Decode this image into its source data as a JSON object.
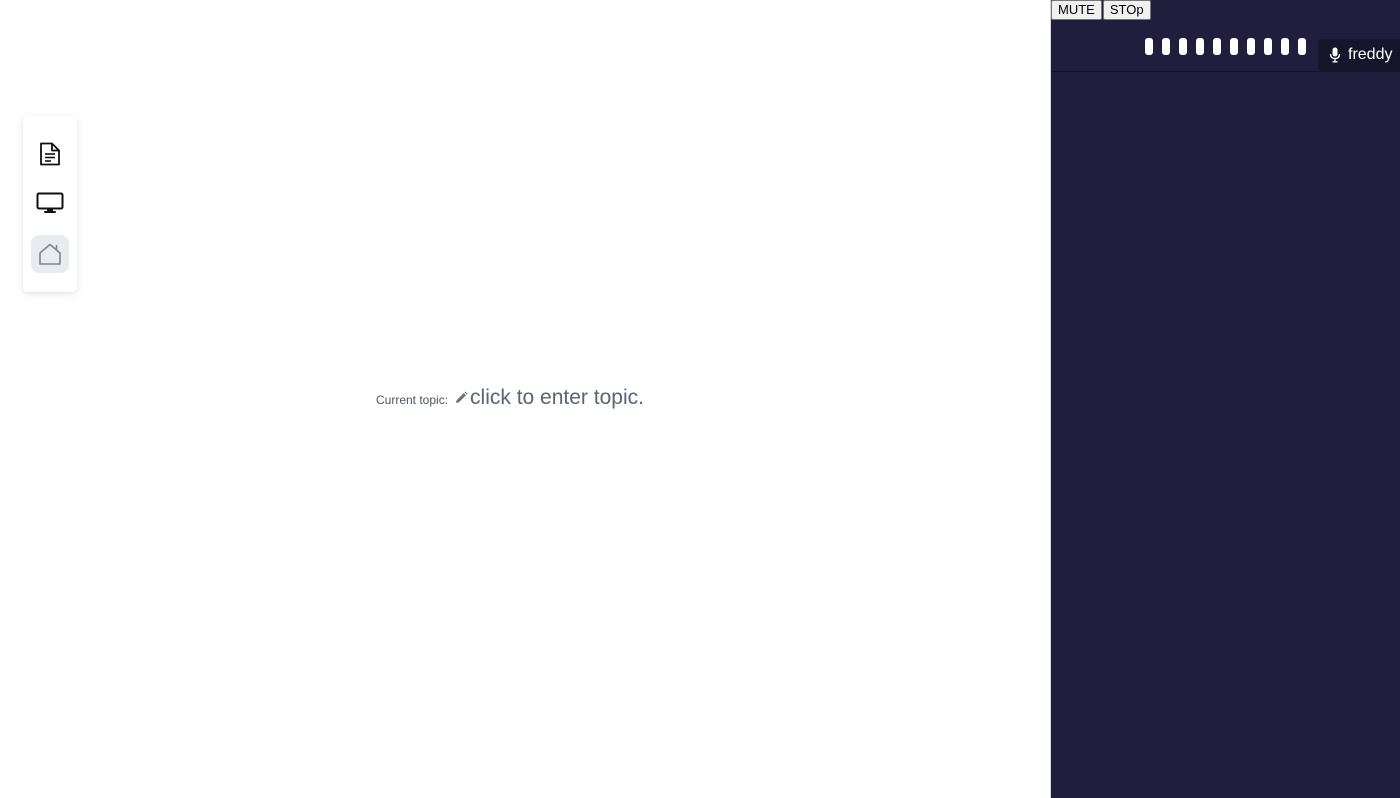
{
  "toolbar": {
    "items": [
      {
        "icon": "document-icon"
      },
      {
        "icon": "monitor-icon"
      },
      {
        "icon": "home-icon",
        "active": true
      }
    ]
  },
  "topic": {
    "label": "Current topic:",
    "placeholder": "click to enter topic.",
    "icon": "pencil-icon"
  },
  "panel": {
    "buttons": {
      "mute": "MUTE",
      "stop": "STOp"
    },
    "audio_meter": {
      "bar_count": 10
    },
    "user": {
      "name": "freddy",
      "icon": "microphone-icon"
    }
  },
  "colors": {
    "panel_bg": "#1f1f3d",
    "chip_bg": "#15152c",
    "active_tool_bg": "#e9ecef",
    "topic_text": "#5b6472"
  }
}
